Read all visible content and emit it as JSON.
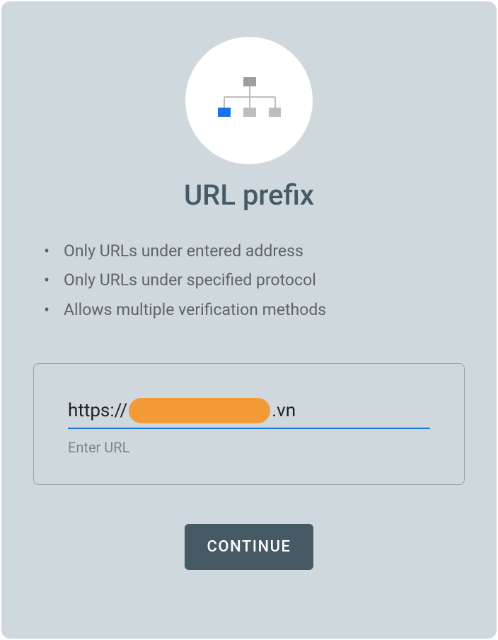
{
  "title": "URL prefix",
  "features": {
    "items": [
      "Only URLs under entered address",
      "Only URLs under specified protocol",
      "Allows multiple verification methods"
    ]
  },
  "input": {
    "url_prefix": "https://",
    "url_suffix": ".vn",
    "label": "Enter URL"
  },
  "button": {
    "continue": "CONTINUE"
  }
}
